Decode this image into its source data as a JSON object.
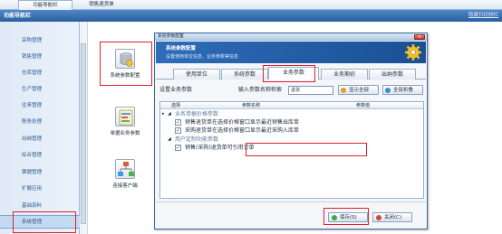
{
  "top_tabs": [
    "功能导航栏",
    "销售退货单"
  ],
  "nav_header": {
    "title": "功能导航栏",
    "link": "隐藏扫码侧栏"
  },
  "sidebar": {
    "items": [
      "采购管理",
      "销售管理",
      "仓库管理",
      "生产管理",
      "往来管理",
      "账务处理",
      "出纳管理",
      "综合管理",
      "票据管理",
      "扩展应用",
      "基础资料",
      "系统管理"
    ],
    "active_index": 11
  },
  "launchers": [
    {
      "label": "系统参数配置",
      "icon": "database-settings-icon"
    },
    {
      "label": "单据业务参数",
      "icon": "document-settings-icon"
    },
    {
      "label": "连接客户端",
      "icon": "network-clients-icon"
    }
  ],
  "dialog": {
    "title": "系统参数配置",
    "banner_title": "系统参数配置",
    "banner_subtitle": "设置使用单位信息、业务参数等信息",
    "tabs": [
      "使用单位",
      "系统参数",
      "业务参数",
      "业务期初",
      "出纳参数"
    ],
    "active_tab": 2,
    "toolbar": {
      "label": "设置业务参数",
      "search_label": "输入参数名称检索",
      "search_value": "退货",
      "expand_all": "显示全部",
      "collapse_all": "全部折叠"
    },
    "grid": {
      "columns": [
        "选择",
        "参数名称",
        "参数值"
      ],
      "rows": [
        {
          "type": "group",
          "text": "业务单据价格参数"
        },
        {
          "type": "item",
          "checked": true,
          "text": "销售退货单在选择价格窗口显示最近销售出库单"
        },
        {
          "type": "item",
          "checked": true,
          "text": "采购退货单在选择价格窗口显示最近采购入库单"
        },
        {
          "type": "group",
          "text": "用户定制功能参数"
        },
        {
          "type": "item",
          "checked": true,
          "text": "销售(采购)退货单可引用订单"
        }
      ]
    },
    "buttons": {
      "save": "保存(S)",
      "close": "关闭(C)"
    }
  },
  "colors": {
    "accent": "#2e6db8",
    "highlight": "#e0202a",
    "nav_header": "#3a70b2"
  }
}
